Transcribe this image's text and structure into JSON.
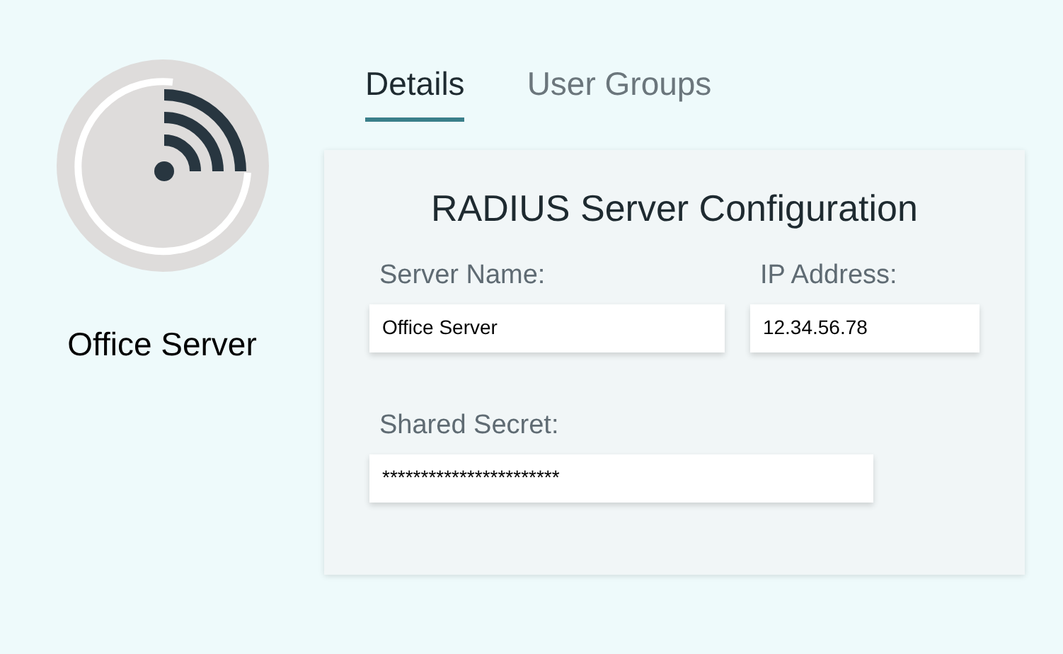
{
  "server": {
    "name": "Office Server"
  },
  "tabs": [
    {
      "label": "Details",
      "selected": true
    },
    {
      "label": "User Groups",
      "selected": false
    }
  ],
  "card": {
    "title": "RADIUS Server Configuration",
    "fields": [
      {
        "label": "Server Name:",
        "value": "Office Server"
      },
      {
        "label": "IP Address:",
        "value": "12.34.56.78"
      },
      {
        "label": "Shared Secret:",
        "value": "***********************"
      }
    ]
  }
}
